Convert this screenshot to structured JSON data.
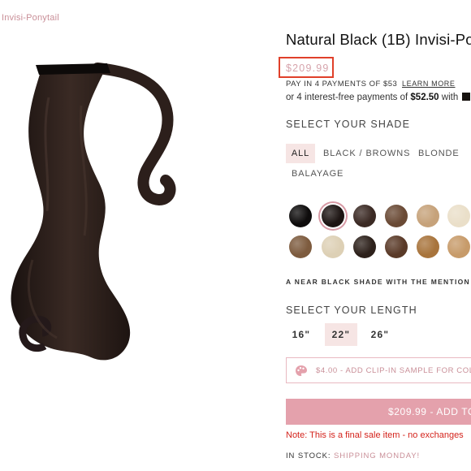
{
  "breadcrumb": "Invisi-Ponytail",
  "product": {
    "title": "Natural Black (1B) Invisi-Po",
    "price": "$209.99",
    "installments_text": "PAY IN 4 PAYMENTS OF $53",
    "learn_more": "LEARN MORE",
    "interest_free_prefix": "or 4 interest-free payments of ",
    "interest_free_amount": "$52.50",
    "interest_free_suffix": " with "
  },
  "shade": {
    "label": "SELECT YOUR SHADE",
    "filters": [
      "ALL",
      "BLACK / BROWNS",
      "BLONDE",
      "BALAYAGE"
    ],
    "active_filter": "ALL",
    "swatch_colors": [
      "#0e0c0c",
      "#1d1513",
      "#3b2a24",
      "#6a4a35",
      "#c6a27a",
      "#eadfc9",
      "#7d5b3e",
      "#ddd0b5",
      "#2d211b",
      "#5a3a28",
      "#a8743c",
      "#c79b6a"
    ],
    "selected_swatch_index": 1,
    "description": "A NEAR BLACK SHADE WITH THE MENTION O"
  },
  "length": {
    "label": "SELECT YOUR LENGTH",
    "options": [
      "16\"",
      "22\"",
      "26\""
    ],
    "selected": "22\""
  },
  "sample_button": "$4.00 - ADD CLIP-IN SAMPLE FOR COLO",
  "add_to_cart": "$209.99 - ADD TO",
  "final_sale_note": "Note: This is a final sale item - no exchanges",
  "stock": {
    "prefix": "IN STOCK: ",
    "shipping": "SHIPPING MONDAY!"
  },
  "colors": {
    "accent_pink": "#e4a1ac",
    "highlight_box": "#e0402a",
    "final_sale_red": "#d4231c",
    "chip_bg": "#f6e5e4"
  }
}
